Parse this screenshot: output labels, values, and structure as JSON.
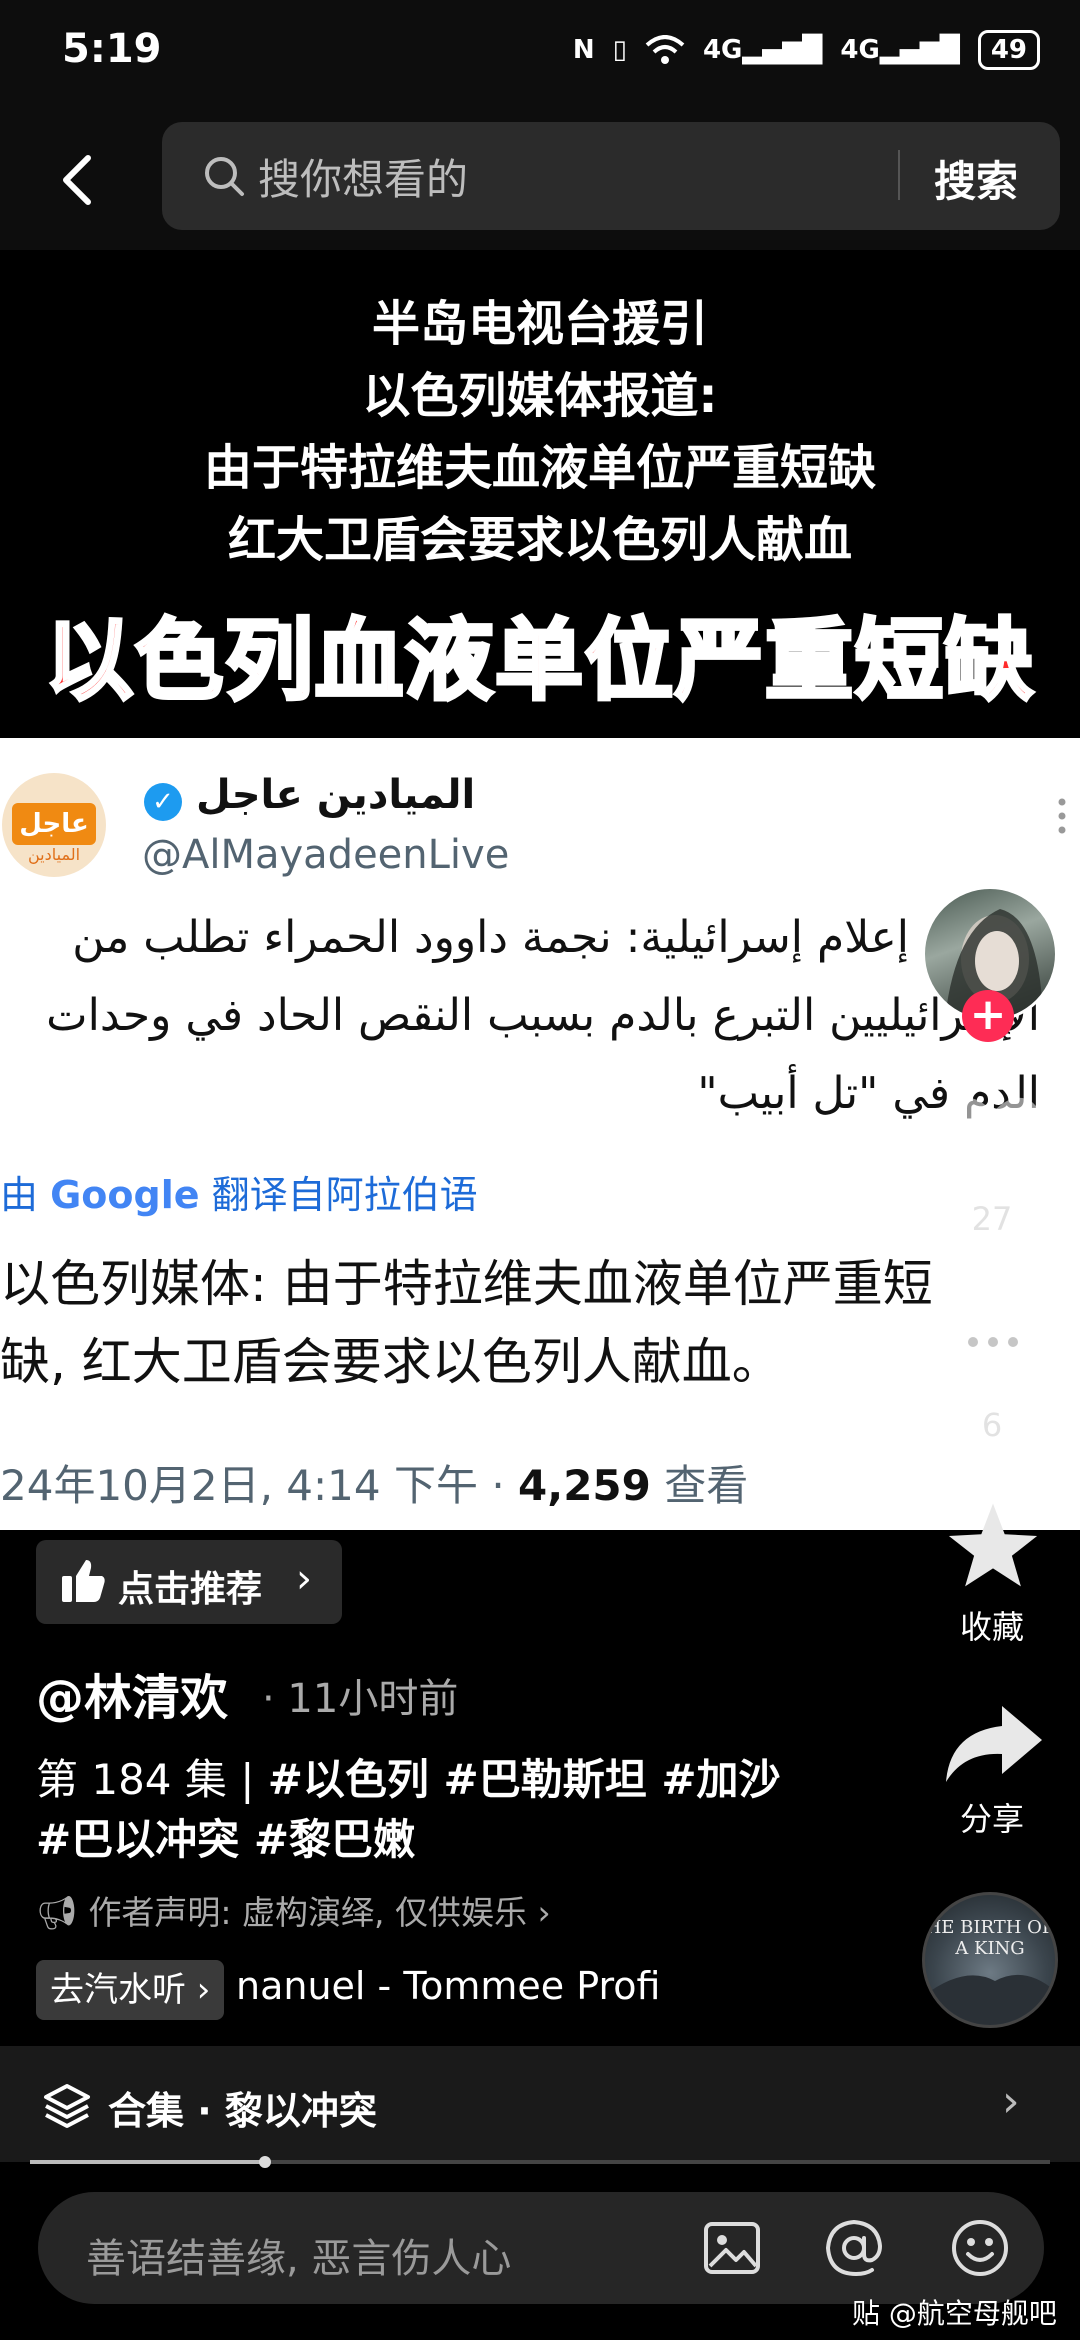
{
  "status_bar": {
    "time": "5:19",
    "net1": "4G",
    "net2": "4G",
    "battery": "49"
  },
  "search": {
    "placeholder": "搜你想看的",
    "button": "搜索"
  },
  "headline": {
    "lines": [
      "半岛电视台援引",
      "以色列媒体报道:",
      "由于特拉维夫血液单位严重短缺",
      "红大卫盾会要求以色列人献血"
    ],
    "big": "以色列血液单位严重短缺"
  },
  "tweet": {
    "avatar_text": "عاجل",
    "avatar_sub": "الميادين",
    "name": "الميادين عاجل",
    "handle": "@AlMayadeenLive",
    "arabic_lines": [
      "وسائل إعلام إسرائيلية: نجمة داوود الحمراء تطلب من",
      "الإسرائيليين التبرع بالدم بسبب النقص الحاد في وحدات",
      "الدم في \"تل أبيب\""
    ],
    "translate_prefix": "由",
    "translate_google": "Google",
    "translate_suffix": "翻译自阿拉伯语",
    "cn_lines": [
      "以色列媒体: 由于特拉维夫血液单位严重短",
      "缺, 红大卫盾会要求以色列人献血。"
    ],
    "date": "24年10月2日, 4:14 下午 · ",
    "views": "4,259",
    "views_label": " 查看"
  },
  "side": {
    "like_count": "27",
    "comment_count": "6",
    "collect_label": "收藏",
    "share_label": "分享",
    "disc_text": "HE BIRTH OF A KING"
  },
  "info": {
    "recommend": "点击推荐",
    "author": "@林清欢",
    "time_ago": "· 11小时前",
    "episode": "第 184 集 | ",
    "tags_line1": "#以色列 #巴勒斯坦 #加沙",
    "tags_line2": "#巴以冲突 #黎巴嫩",
    "disclaimer": "作者声明: 虚构演绎, 仅供娱乐 ›",
    "music_tag": "去汽水听 ›",
    "music_title": "nanuel - Tommee Profi"
  },
  "collection": {
    "label": "合集 · 黎以冲突",
    "progress": 0.23
  },
  "comment": {
    "placeholder": "善语结善缘, 恶言伤人心"
  },
  "watermark": "贴 @航空母舰吧",
  "colors": {
    "accent_red": "#ff2b2b",
    "follow_pink": "#fe2c55",
    "link_blue": "#1d6bd8",
    "verified": "#1d9bf0"
  }
}
